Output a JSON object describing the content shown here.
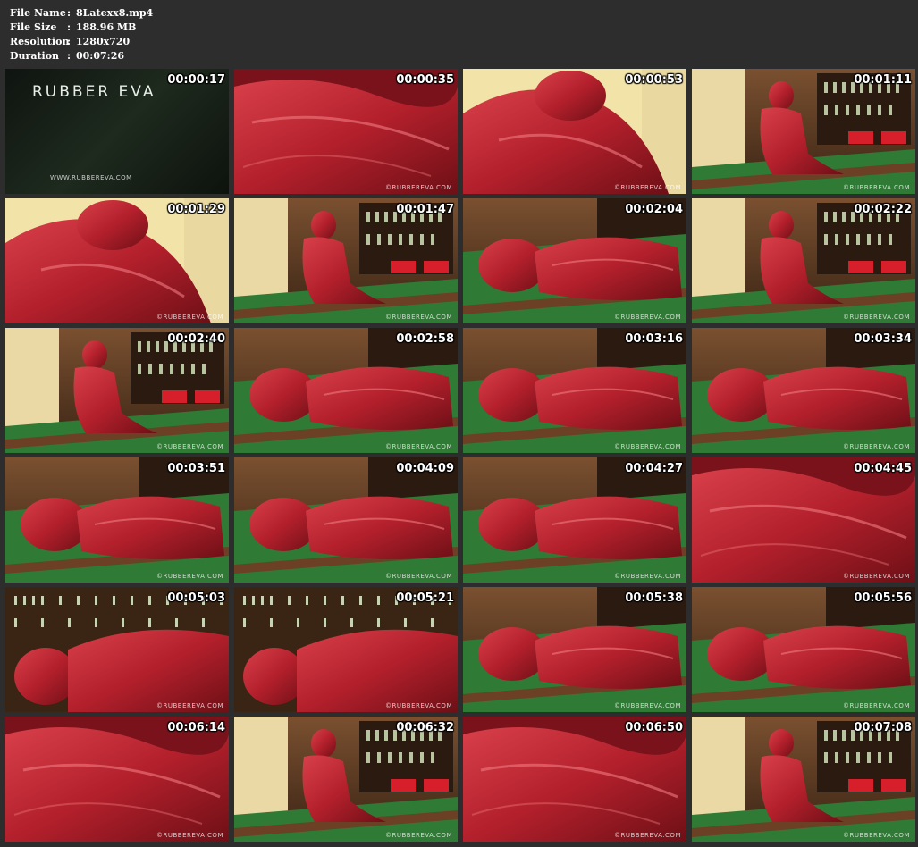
{
  "info": {
    "rows": [
      {
        "key": "File Name",
        "value": "8Latexx8.mp4"
      },
      {
        "key": "File Size",
        "value": "188.96 MB"
      },
      {
        "key": "Resolution",
        "value": "1280x720"
      },
      {
        "key": "Duration",
        "value": "00:07:26"
      }
    ]
  },
  "title_card": {
    "brand": "RUBBER EVA",
    "site": "WWW.RUBBEREVA.COM"
  },
  "watermark": "©RUBBEREVA.COM",
  "thumbnails": [
    {
      "time": "00:00:17",
      "scene": "title"
    },
    {
      "time": "00:00:35",
      "scene": "closeup"
    },
    {
      "time": "00:00:53",
      "scene": "closeup-bright"
    },
    {
      "time": "00:01:11",
      "scene": "room-seated"
    },
    {
      "time": "00:01:29",
      "scene": "closeup-bright"
    },
    {
      "time": "00:01:47",
      "scene": "room-seated"
    },
    {
      "time": "00:02:04",
      "scene": "table-lying"
    },
    {
      "time": "00:02:22",
      "scene": "room-seated"
    },
    {
      "time": "00:02:40",
      "scene": "room-seated"
    },
    {
      "time": "00:02:58",
      "scene": "table-lying"
    },
    {
      "time": "00:03:16",
      "scene": "table-lying"
    },
    {
      "time": "00:03:34",
      "scene": "table-lying"
    },
    {
      "time": "00:03:51",
      "scene": "table-lying"
    },
    {
      "time": "00:04:09",
      "scene": "table-lying"
    },
    {
      "time": "00:04:27",
      "scene": "table-lying"
    },
    {
      "time": "00:04:45",
      "scene": "closeup"
    },
    {
      "time": "00:05:03",
      "scene": "shelves-lying"
    },
    {
      "time": "00:05:21",
      "scene": "shelves-lying"
    },
    {
      "time": "00:05:38",
      "scene": "table-lying"
    },
    {
      "time": "00:05:56",
      "scene": "table-lying"
    },
    {
      "time": "00:06:14",
      "scene": "closeup"
    },
    {
      "time": "00:06:32",
      "scene": "room-seated"
    },
    {
      "time": "00:06:50",
      "scene": "closeup"
    },
    {
      "time": "00:07:08",
      "scene": "room-seated"
    }
  ],
  "colors": {
    "background": "#2d2d2d",
    "latex": "#b3202c",
    "felt": "#2f7a34",
    "wood": "#5b3a22"
  }
}
